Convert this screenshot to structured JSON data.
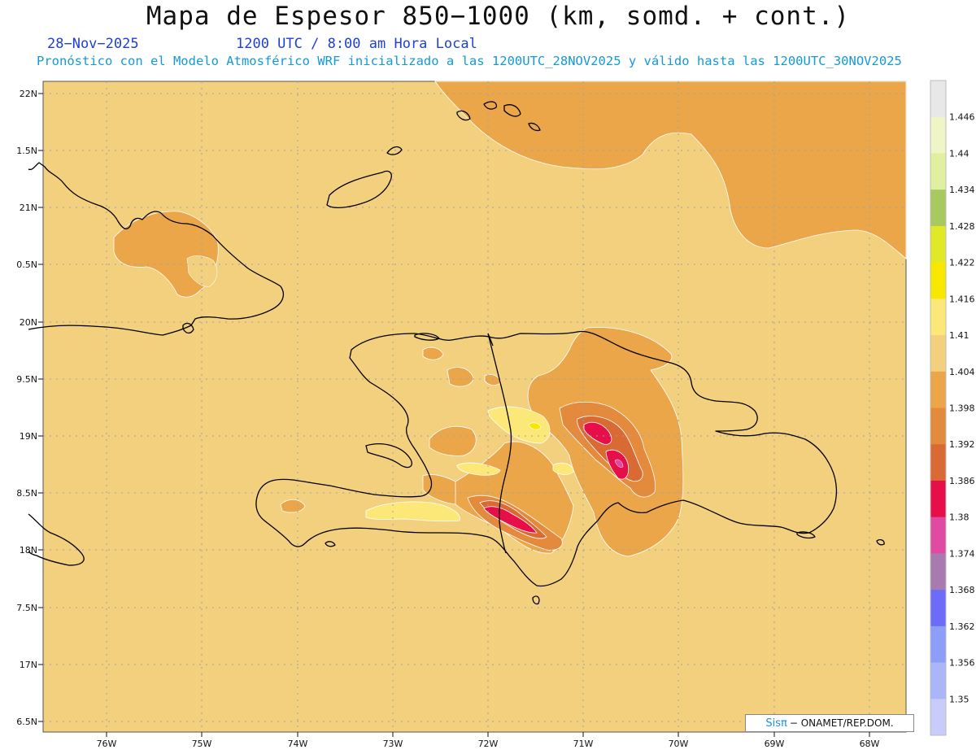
{
  "header": {
    "title": "Mapa de Espesor 850−1000 (km, somd. + cont.)",
    "date": "28−Nov−2025",
    "time": "1200 UTC / 8:00 am Hora Local",
    "subtitle": "Pronóstico con el Modelo Atmosférico WRF inicializado a las 1200UTC_28NOV2025 y válido hasta las  1200UTC_30NOV2025"
  },
  "credit": {
    "brand": "Sisπ",
    "text": "− ONAMET/REP.DOM."
  },
  "axes": {
    "lat_labels": [
      "22N",
      "1.5N",
      "21N",
      "0.5N",
      "20N",
      "9.5N",
      "19N",
      "8.5N",
      "18N",
      "7.5N",
      "17N",
      "6.5N"
    ],
    "lon_labels": [
      "76W",
      "75W",
      "74W",
      "73W",
      "72W",
      "71W",
      "70W",
      "69W",
      "68W"
    ]
  },
  "colorbar": {
    "labels": [
      "1.446",
      "1.44",
      "1.434",
      "1.428",
      "1.422",
      "1.416",
      "1.41",
      "1.404",
      "1.398",
      "1.392",
      "1.386",
      "1.38",
      "1.374",
      "1.368",
      "1.362",
      "1.356",
      "1.35"
    ],
    "colors": [
      "#e8e8e8",
      "#f0f5c8",
      "#e0f0a0",
      "#a8c860",
      "#e0e828",
      "#f8e800",
      "#fce878",
      "#f2d07e",
      "#eba64a",
      "#e38a3c",
      "#d96a34",
      "#e60f4a",
      "#e04aa0",
      "#a87ab0",
      "#6c6cf8",
      "#8c9ef8",
      "#aab6f8",
      "#c8ccfa"
    ]
  },
  "map": {
    "background_color": "#f2d07e",
    "contour_colors": {
      "low": "#eba64a",
      "lower": "#e38a3c",
      "lowest": "#d96a34",
      "min": "#e60f4a",
      "high": "#fce878",
      "highest": "#f8e800"
    }
  }
}
